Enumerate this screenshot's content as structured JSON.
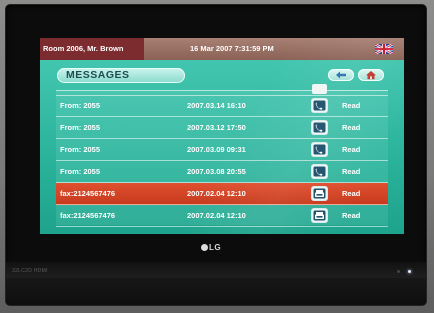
{
  "header": {
    "room": "Room 2006, Mr. Brown",
    "datetime": "16 Mar 2007 7:31:59 PM",
    "language_flag": "uk-flag-icon"
  },
  "page": {
    "title": "MESSAGES",
    "back_icon": "back-arrow-icon",
    "home_icon": "home-icon"
  },
  "messages": [
    {
      "from": "From: 2055",
      "date": "2007.03.14 16:10",
      "type": "phone",
      "status": "Read",
      "selected": false
    },
    {
      "from": "From: 2055",
      "date": "2007.03.12 17:50",
      "type": "phone",
      "status": "Read",
      "selected": false
    },
    {
      "from": "From: 2055",
      "date": "2007.03.09 09:31",
      "type": "phone",
      "status": "Read",
      "selected": false
    },
    {
      "from": "From: 2055",
      "date": "2007.03.08 20:55",
      "type": "phone",
      "status": "Read",
      "selected": false
    },
    {
      "from": "fax:2124567476",
      "date": "2007.02.04 12:10",
      "type": "fax",
      "status": "Read",
      "selected": true
    },
    {
      "from": "fax:2124567476",
      "date": "2007.02.04 12:10",
      "type": "fax",
      "status": "Read",
      "selected": false
    }
  ],
  "device": {
    "brand": "LG",
    "model": "32LC2D HDMI"
  },
  "colors": {
    "screen_bg": "#2bb39c",
    "room_label_bg": "#7c2b2e",
    "selected_row": "#d5452a",
    "topbar": "#9a7064"
  }
}
